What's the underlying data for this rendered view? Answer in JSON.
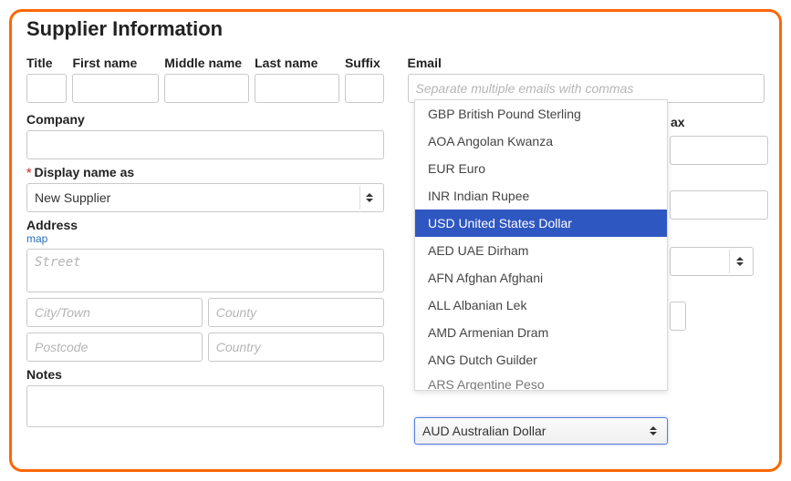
{
  "title": "Supplier Information",
  "left": {
    "labels": {
      "title": "Title",
      "first": "First name",
      "middle": "Middle name",
      "last": "Last name",
      "suffix": "Suffix",
      "company": "Company",
      "display": "Display name as",
      "address": "Address",
      "map": "map",
      "notes": "Notes"
    },
    "display_value": "New Supplier",
    "placeholders": {
      "street": "Street",
      "city": "City/Town",
      "county": "County",
      "postcode": "Postcode",
      "country": "Country"
    }
  },
  "right": {
    "labels": {
      "email": "Email",
      "fax_fragment": "ax"
    },
    "email_placeholder": "Separate multiple emails with commas"
  },
  "currency_dropdown": {
    "options": [
      "GBP British Pound Sterling",
      "AOA Angolan Kwanza",
      "EUR Euro",
      "INR Indian Rupee",
      "USD United States Dollar",
      "AED UAE Dirham",
      "AFN Afghan Afghani",
      "ALL Albanian Lek",
      "AMD Armenian Dram",
      "ANG Dutch Guilder",
      "ARS Argentine Peso"
    ],
    "selected_index": 4,
    "field_value": "AUD Australian Dollar"
  }
}
